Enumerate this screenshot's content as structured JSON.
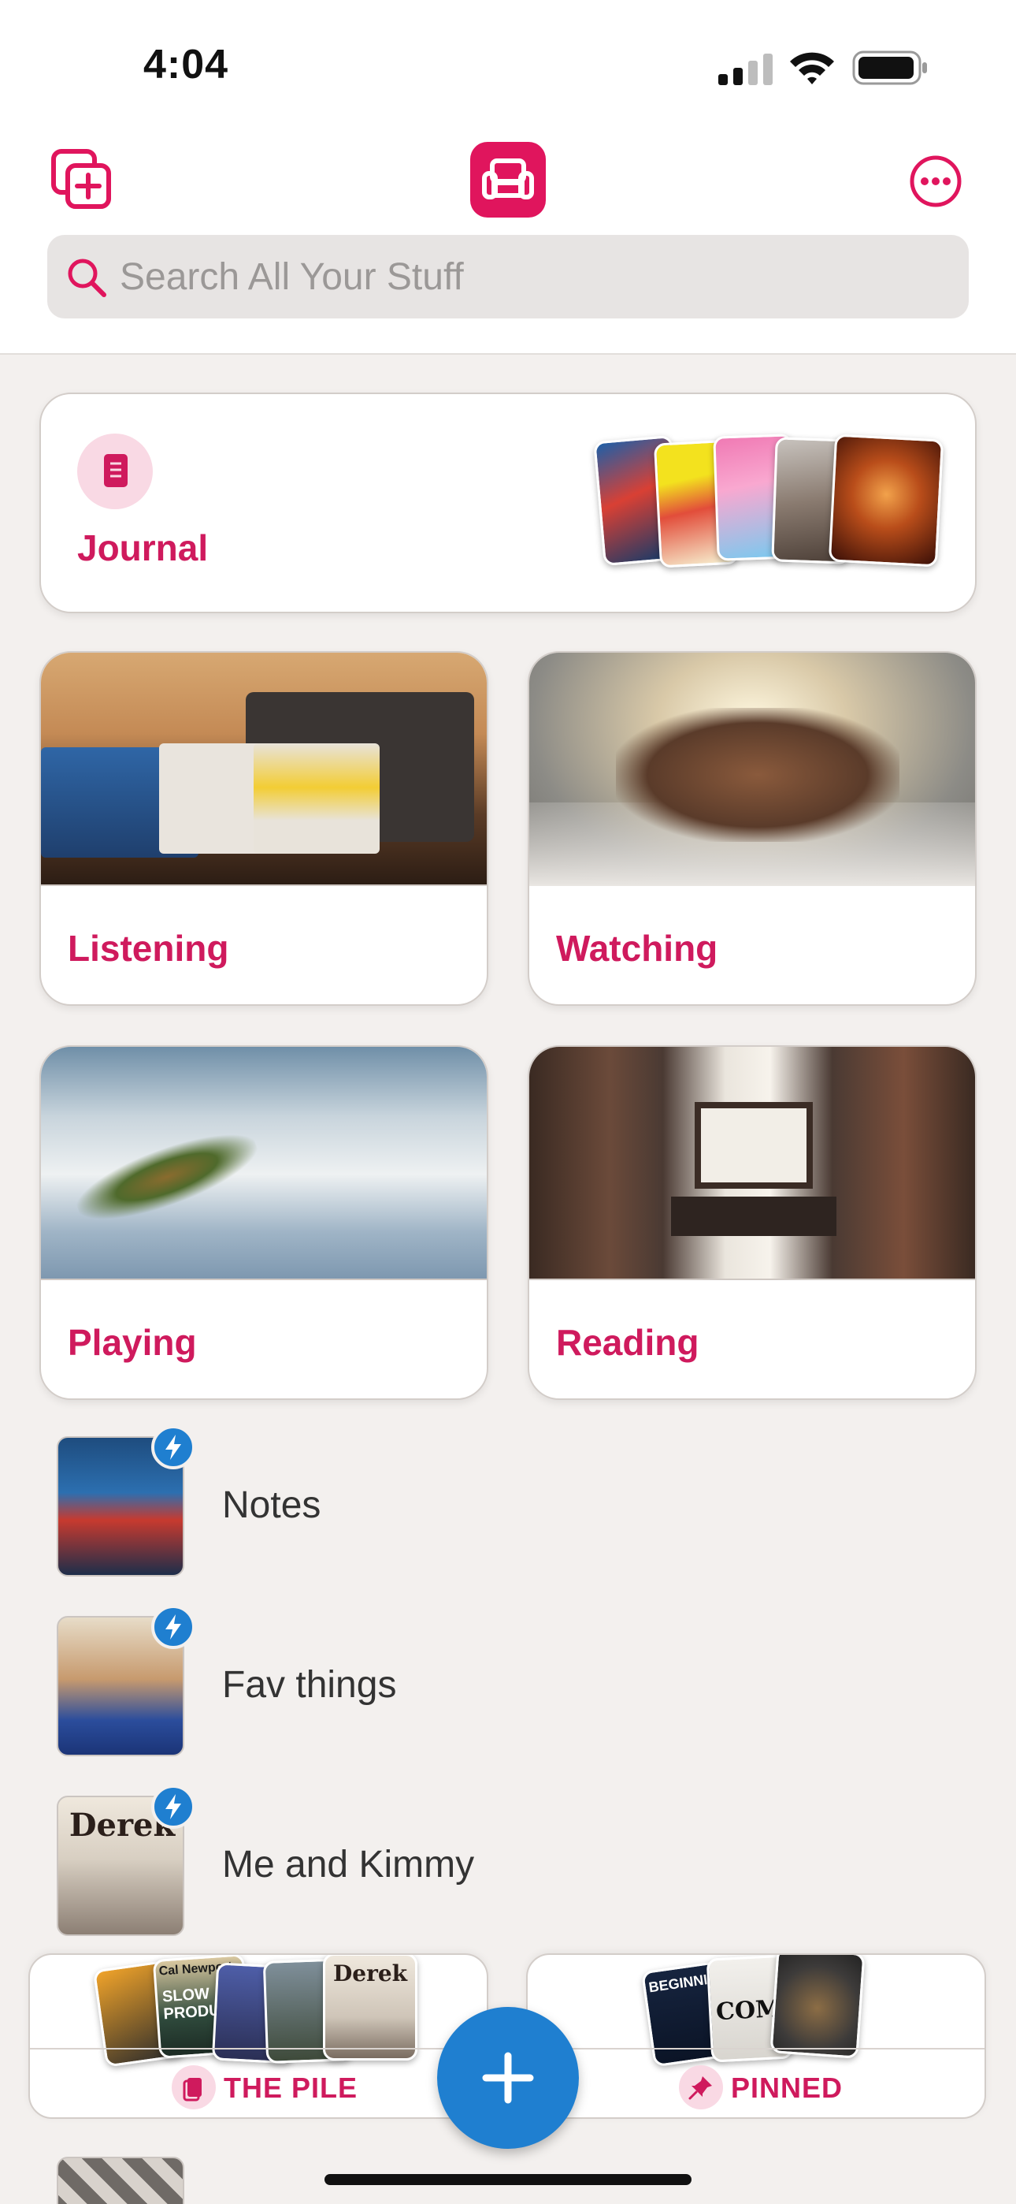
{
  "status_bar": {
    "time": "4:04"
  },
  "header": {
    "search_placeholder": "Search All Your Stuff",
    "accent_color": "#e0155d"
  },
  "journal": {
    "title": "Journal"
  },
  "categories": [
    {
      "title": "Listening"
    },
    {
      "title": "Watching"
    },
    {
      "title": "Playing"
    },
    {
      "title": "Reading"
    }
  ],
  "collections": [
    {
      "label": "Notes",
      "icon": "bolt-icon"
    },
    {
      "label": "Fav things",
      "icon": "bolt-icon"
    },
    {
      "label": "Me and Kimmy",
      "icon": "bolt-icon",
      "thumb_text": "Derek"
    }
  ],
  "bottom_bar": {
    "pile_label": "THE PILE",
    "pinned_label": "PINNED",
    "pile_thumb_texts": [
      "Cal Newport",
      "SLOW PRODUCT",
      "Derek"
    ],
    "pinned_thumb_texts": [
      "BEGINNI",
      "COMI"
    ],
    "fab_icon": "plus-icon"
  }
}
